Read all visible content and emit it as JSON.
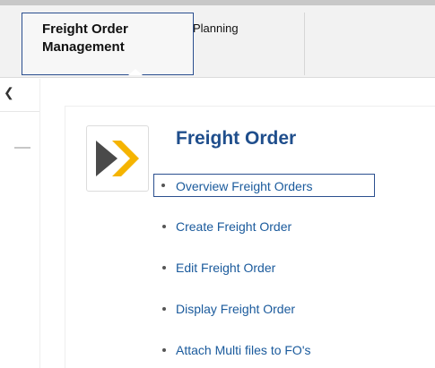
{
  "nav": {
    "tabs": [
      {
        "label": "Freight Order Management",
        "active": true
      },
      {
        "label": "Planning",
        "active": false
      }
    ]
  },
  "card": {
    "title": "Freight Order",
    "icon": "chevron-arrow-icon",
    "links": [
      {
        "label": "Overview Freight Orders",
        "selected": true
      },
      {
        "label": "Create Freight Order",
        "selected": false
      },
      {
        "label": "Edit Freight Order",
        "selected": false
      },
      {
        "label": "Display Freight Order",
        "selected": false
      },
      {
        "label": "Attach Multi files to FO's",
        "selected": false
      }
    ]
  },
  "colors": {
    "title": "#1f4e8c",
    "link": "#1a5a9c",
    "highlight_border": "#2b4f8f",
    "icon_dark": "#4a4a4a",
    "icon_accent": "#f5b400"
  }
}
